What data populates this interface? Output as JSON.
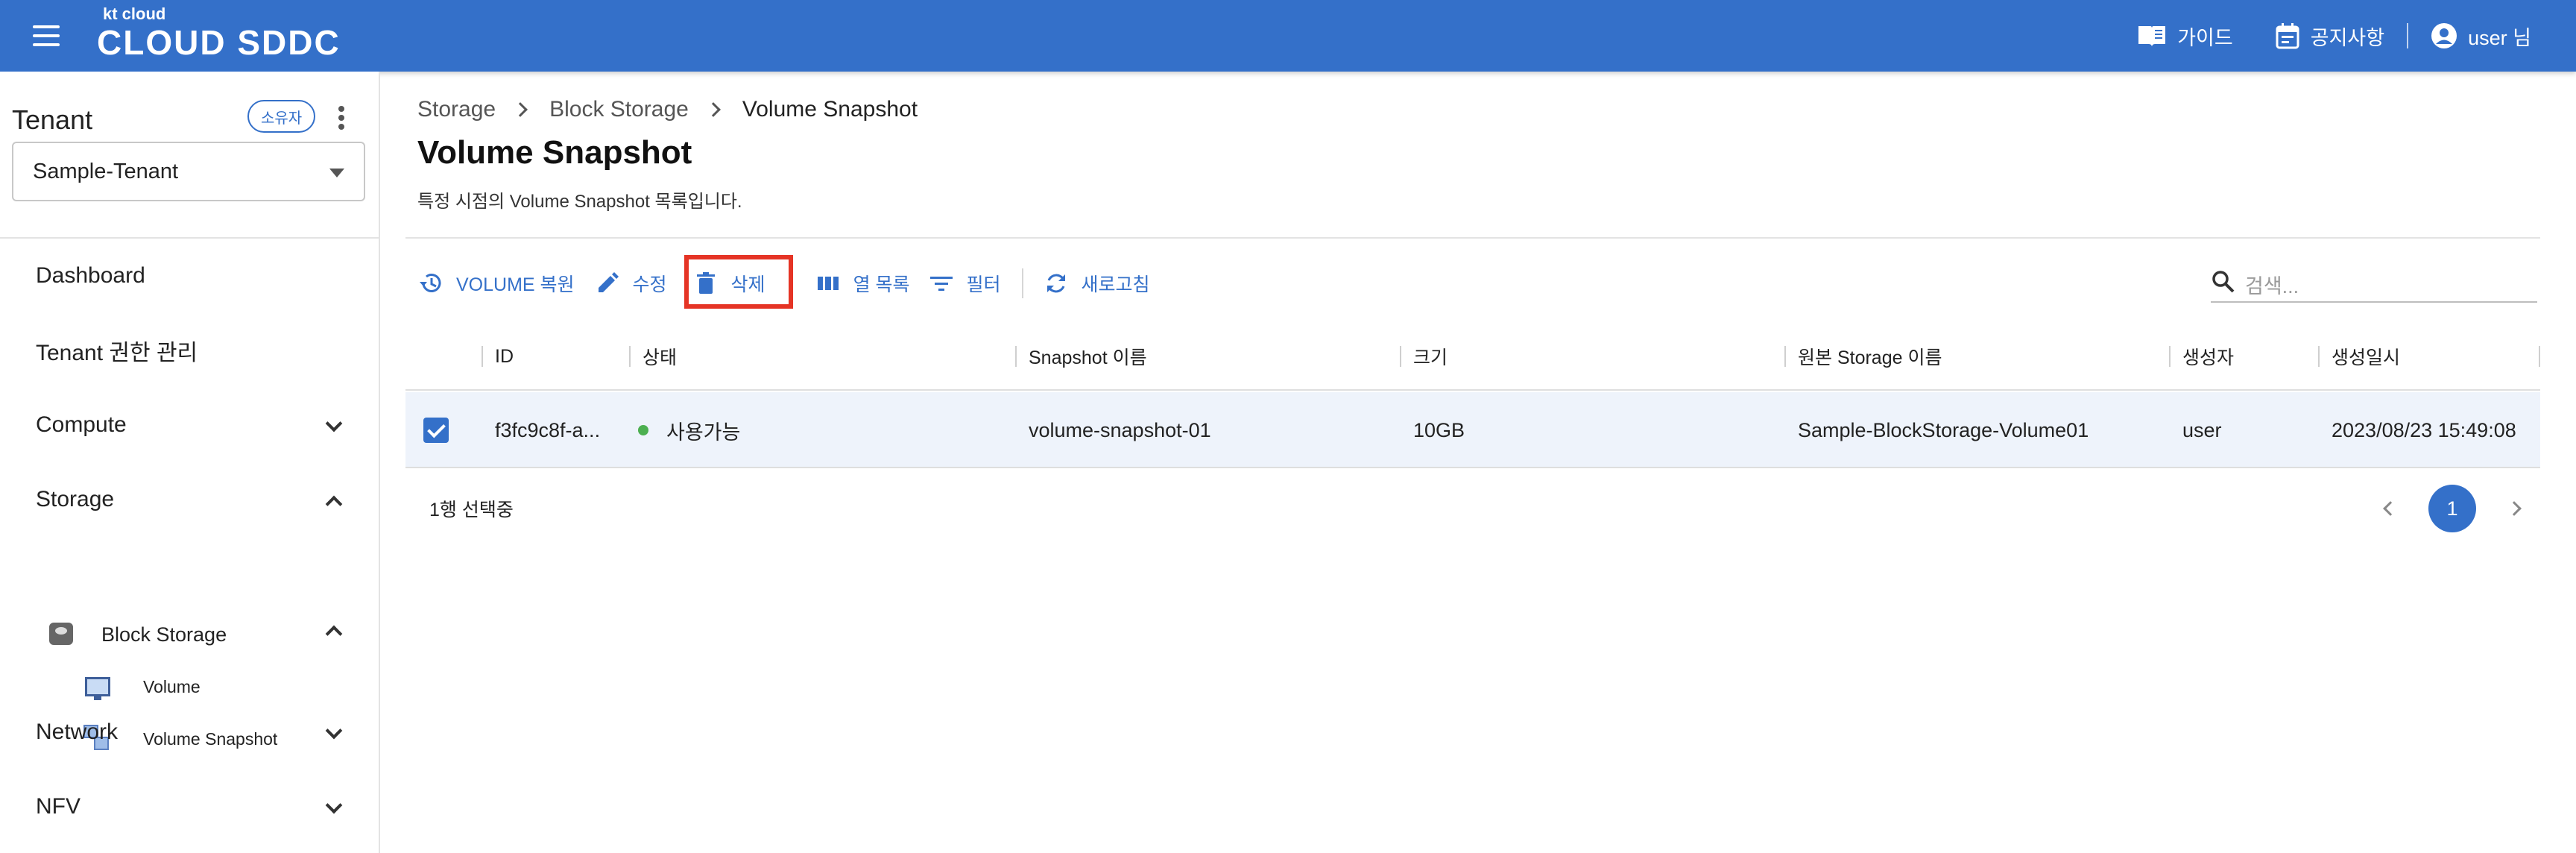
{
  "header": {
    "logo_small": "kt cloud",
    "logo_big": "CLOUD SDDC",
    "guide": "가이드",
    "notice": "공지사항",
    "user": "user 님",
    "color": "#3470c9"
  },
  "sidebar": {
    "tenant_title": "Tenant",
    "owner_badge": "소유자",
    "tenant_selected": "Sample-Tenant",
    "items": [
      {
        "label": "Dashboard"
      },
      {
        "label": "Tenant 권한 관리"
      },
      {
        "label": "Compute"
      },
      {
        "label": "Storage"
      },
      {
        "label": "Network"
      },
      {
        "label": "NFV"
      }
    ],
    "storage_children": {
      "block_storage": "Block Storage",
      "volume": "Volume",
      "volume_snapshot": "Volume Snapshot"
    }
  },
  "breadcrumb": [
    "Storage",
    "Block Storage",
    "Volume Snapshot"
  ],
  "page": {
    "title": "Volume Snapshot",
    "description": "특정 시점의 Volume Snapshot 목록입니다."
  },
  "toolbar": {
    "restore": "VOLUME 복원",
    "edit": "수정",
    "delete": "삭제",
    "columns": "열 목록",
    "filter": "필터",
    "refresh": "새로고침",
    "highlight_color": "#e53425"
  },
  "search": {
    "placeholder": "검색..."
  },
  "table": {
    "columns": [
      "ID",
      "상태",
      "Snapshot 이름",
      "크기",
      "원본 Storage 이름",
      "생성자",
      "생성일시"
    ],
    "rows": [
      {
        "id": "f3fc9c8f-a...",
        "status": "사용가능",
        "name": "volume-snapshot-01",
        "size": "10GB",
        "source": "Sample-BlockStorage-Volume01",
        "creator": "user",
        "created": "2023/08/23 15:49:08",
        "selected": true
      }
    ]
  },
  "footer": {
    "selected_text": "1행 선택중",
    "page": "1"
  }
}
